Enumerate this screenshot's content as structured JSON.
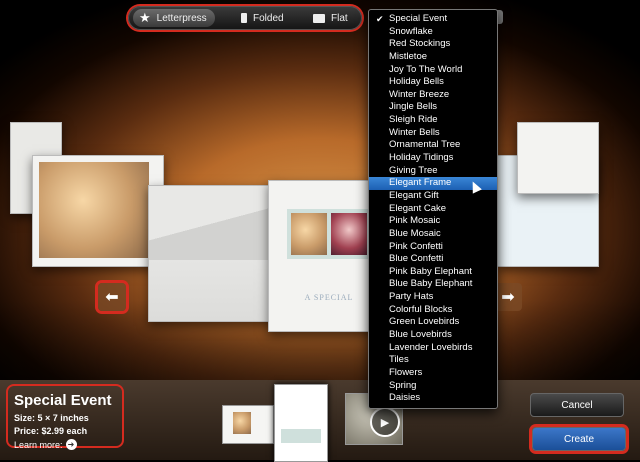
{
  "segmented": {
    "options": [
      {
        "label": "Letterpress",
        "icon": "star-icon"
      },
      {
        "label": "Folded",
        "icon": "folded-card-icon"
      },
      {
        "label": "Flat",
        "icon": "flat-card-icon"
      }
    ]
  },
  "theme_menu": {
    "selected": "Special Event",
    "highlighted": "Elegant Frame",
    "items": [
      "Special Event",
      "Snowflake",
      "Red Stockings",
      "Mistletoe",
      "Joy To The World",
      "Holiday Bells",
      "Winter Breeze",
      "Jingle Bells",
      "Sleigh Ride",
      "Winter Bells",
      "Ornamental Tree",
      "Holiday Tidings",
      "Giving Tree",
      "Elegant Frame",
      "Elegant Gift",
      "Elegant Cake",
      "Pink Mosaic",
      "Blue Mosaic",
      "Pink Confetti",
      "Blue Confetti",
      "Pink Baby Elephant",
      "Blue Baby Elephant",
      "Party Hats",
      "Colorful Blocks",
      "Green Lovebirds",
      "Blue Lovebirds",
      "Lavender Lovebirds",
      "Tiles",
      "Flowers",
      "Spring",
      "Daisies"
    ]
  },
  "card_caption": "A SPECIAL",
  "info": {
    "title": "Special Event",
    "size_label": "Size:",
    "size_value": "5 × 7 inches",
    "price_label": "Price:",
    "price_value": "$2.99 each",
    "learn_more": "Learn more:"
  },
  "buttons": {
    "cancel": "Cancel",
    "create": "Create"
  },
  "colors": {
    "highlight_red": "#d42b1f",
    "menu_highlight": "#2a75c8",
    "create_blue": "#2a62b3"
  }
}
